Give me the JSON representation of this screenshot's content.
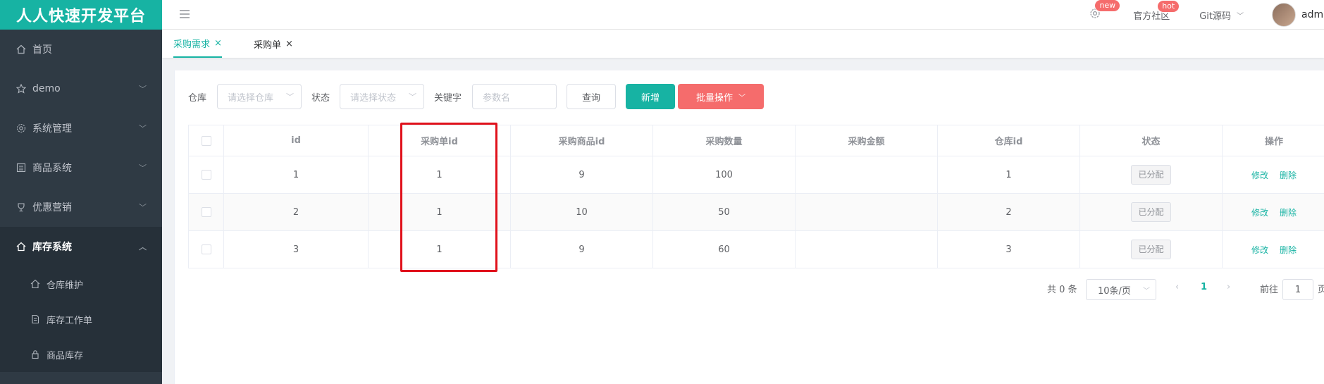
{
  "brand": "人人快速开发平台",
  "sidebar": {
    "items": [
      {
        "label": "首页",
        "icon": "home-icon"
      },
      {
        "label": "demo",
        "icon": "star-icon"
      },
      {
        "label": "系统管理",
        "icon": "gear-icon"
      },
      {
        "label": "商品系统",
        "icon": "grid-icon"
      },
      {
        "label": "优惠营销",
        "icon": "trophy-icon"
      },
      {
        "label": "库存系统",
        "icon": "home-icon"
      }
    ],
    "submenu": [
      {
        "label": "仓库维护",
        "icon": "home-icon"
      },
      {
        "label": "库存工作单",
        "icon": "document-icon"
      },
      {
        "label": "商品库存",
        "icon": "lock-icon"
      }
    ]
  },
  "topbar": {
    "badge_new": "new",
    "community": "官方社区",
    "badge_hot": "hot",
    "git": "Git源码",
    "user": "admin"
  },
  "tabs": [
    {
      "label": "采购需求"
    },
    {
      "label": "采购单"
    }
  ],
  "filter": {
    "warehouse_label": "仓库",
    "warehouse_placeholder": "请选择仓库",
    "status_label": "状态",
    "status_placeholder": "请选择状态",
    "keyword_label": "关键字",
    "keyword_placeholder": "参数名",
    "query": "查询",
    "add": "新增",
    "batch": "批量操作"
  },
  "table": {
    "headers": [
      "id",
      "采购单id",
      "采购商品id",
      "采购数量",
      "采购金额",
      "仓库id",
      "状态",
      "操作"
    ],
    "rows": [
      {
        "id": "1",
        "purchase_id": "1",
        "sku_id": "9",
        "qty": "100",
        "amount": "",
        "ware_id": "1",
        "status": "已分配"
      },
      {
        "id": "2",
        "purchase_id": "1",
        "sku_id": "10",
        "qty": "50",
        "amount": "",
        "ware_id": "2",
        "status": "已分配"
      },
      {
        "id": "3",
        "purchase_id": "1",
        "sku_id": "9",
        "qty": "60",
        "amount": "",
        "ware_id": "3",
        "status": "已分配"
      }
    ],
    "edit": "修改",
    "delete": "删除"
  },
  "pagination": {
    "total": "共 0 条",
    "page_size": "10条/页",
    "current": "1",
    "goto_label": "前往",
    "goto_value": "1",
    "page_suffix": "页"
  },
  "colors": {
    "accent": "#17b3a3",
    "danger": "#f56c6c",
    "sidebar": "#2f3a44",
    "highlight": "#e0111b"
  }
}
